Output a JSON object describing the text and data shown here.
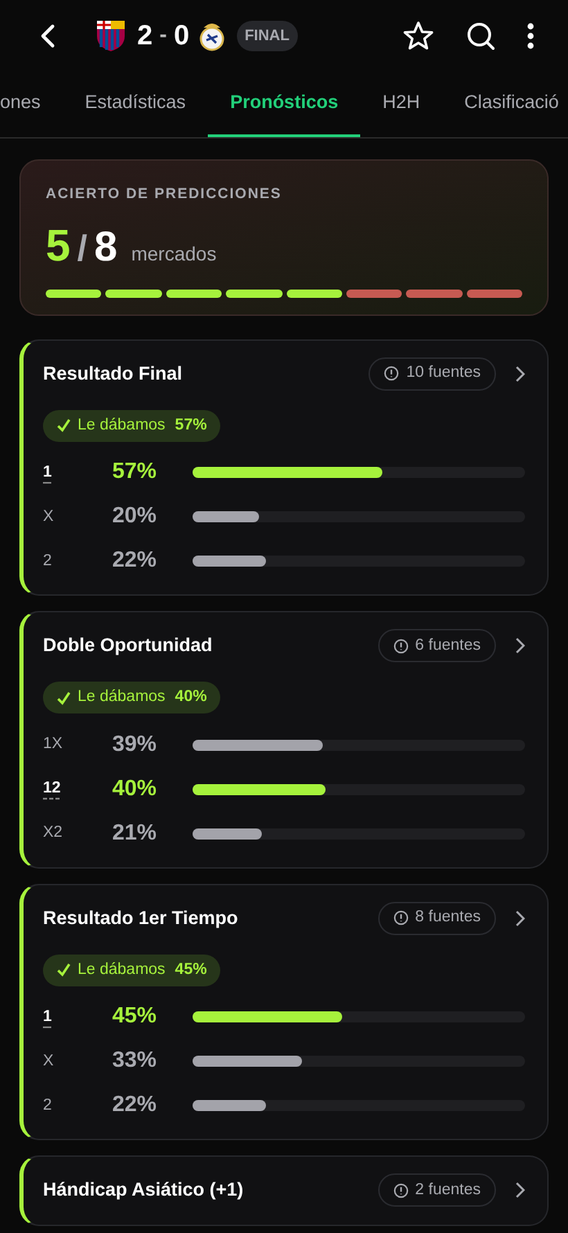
{
  "header": {
    "home_score": "2",
    "separator": "-",
    "away_score": "0",
    "status": "FINAL"
  },
  "tabs": [
    {
      "label": "ones",
      "selected": false
    },
    {
      "label": "Estadísticas",
      "selected": false
    },
    {
      "label": "Pronósticos",
      "selected": true
    },
    {
      "label": "H2H",
      "selected": false
    },
    {
      "label": "Clasificació",
      "selected": false
    }
  ],
  "summary": {
    "title": "ACIERTO DE PREDICCIONES",
    "hits": "5",
    "slash": "/",
    "total": "8",
    "unit": "mercados",
    "segments": [
      {
        "hit": true
      },
      {
        "hit": true
      },
      {
        "hit": true
      },
      {
        "hit": true
      },
      {
        "hit": true
      },
      {
        "hit": false
      },
      {
        "hit": false
      },
      {
        "hit": false
      }
    ]
  },
  "markets": [
    {
      "title": "Resultado Final",
      "sources": "10 fuentes",
      "verdict": {
        "label": "Le dábamos",
        "value": "57%"
      },
      "outcomes": [
        {
          "label": "1",
          "percent": "57%",
          "level": 0.57,
          "selected": true
        },
        {
          "label": "X",
          "percent": "20%",
          "level": 0.2,
          "selected": false
        },
        {
          "label": "2",
          "percent": "22%",
          "level": 0.22,
          "selected": false
        }
      ]
    },
    {
      "title": "Doble Oportunidad",
      "sources": "6 fuentes",
      "verdict": {
        "label": "Le dábamos",
        "value": "40%"
      },
      "outcomes": [
        {
          "label": "1X",
          "percent": "39%",
          "level": 0.39,
          "selected": false
        },
        {
          "label": "12",
          "percent": "40%",
          "level": 0.4,
          "selected": true
        },
        {
          "label": "X2",
          "percent": "21%",
          "level": 0.21,
          "selected": false
        }
      ]
    },
    {
      "title": "Resultado 1er Tiempo",
      "sources": "8 fuentes",
      "verdict": {
        "label": "Le dábamos",
        "value": "45%"
      },
      "outcomes": [
        {
          "label": "1",
          "percent": "45%",
          "level": 0.45,
          "selected": true
        },
        {
          "label": "X",
          "percent": "33%",
          "level": 0.33,
          "selected": false
        },
        {
          "label": "2",
          "percent": "22%",
          "level": 0.22,
          "selected": false
        }
      ]
    },
    {
      "title": "Hándicap Asiático (+1)",
      "sources": "2 fuentes"
    }
  ]
}
